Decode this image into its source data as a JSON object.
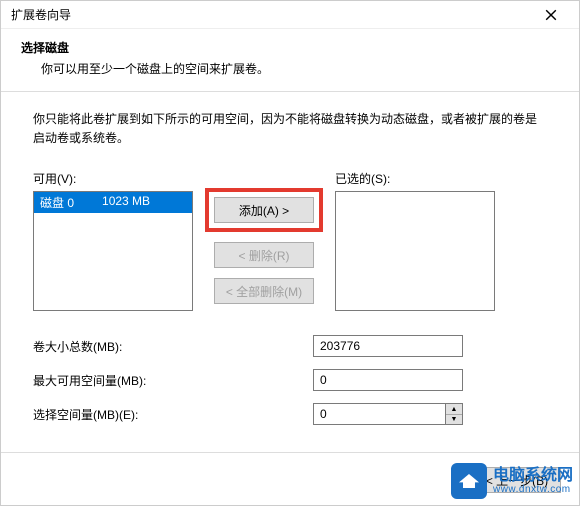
{
  "window": {
    "title": "扩展卷向导",
    "close_label": "Close"
  },
  "header": {
    "heading": "选择磁盘",
    "subheading": "你可以用至少一个磁盘上的空间来扩展卷。"
  },
  "description": "你只能将此卷扩展到如下所示的可用空间，因为不能将磁盘转换为动态磁盘，或者被扩展的卷是启动卷或系统卷。",
  "available": {
    "label": "可用(V):",
    "items": [
      {
        "disk": "磁盘 0",
        "size": "1023 MB"
      }
    ]
  },
  "selected": {
    "label": "已选的(S):"
  },
  "buttons": {
    "add": "添加(A) >",
    "remove": "< 删除(R)",
    "remove_all": "< 全部删除(M)",
    "back": "< 上一步(B)"
  },
  "form": {
    "total_label": "卷大小总数(MB):",
    "total_value": "203776",
    "max_label": "最大可用空间量(MB):",
    "max_value": "0",
    "select_label": "选择空间量(MB)(E):",
    "select_value": "0"
  },
  "watermark": {
    "cn": "电脑系统网",
    "en": "www.dnxtw.com"
  }
}
